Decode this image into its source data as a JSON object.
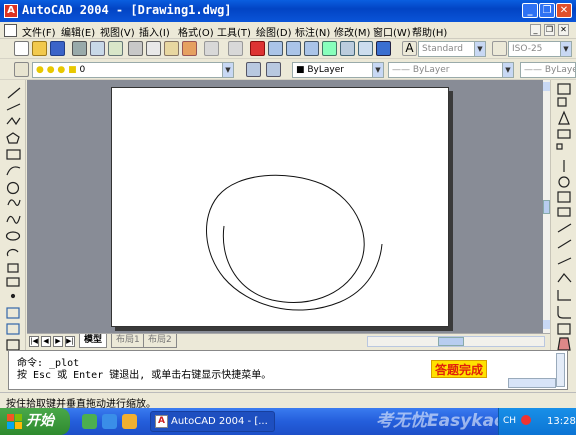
{
  "window": {
    "title": "AutoCAD 2004 - [Drawing1.dwg]",
    "app_icon_label": "A"
  },
  "menu": {
    "items": [
      "文件(F)",
      "编辑(E)",
      "视图(V)",
      "插入(I)",
      "格式(O)",
      "工具(T)",
      "绘图(D)",
      "标注(N)",
      "修改(M)",
      "窗口(W)",
      "帮助(H)"
    ]
  },
  "toolbar": {
    "text_style": "Standard",
    "dim_style": "ISO-25",
    "layer": "0",
    "color": "ByLayer",
    "linetype": "ByLayer",
    "lineweight": "ByLayer"
  },
  "tabs": {
    "model": "模型",
    "layout1": "布局1",
    "layout2": "布局2"
  },
  "command": {
    "line1": "命令: _plot",
    "line2": "按 Esc 或 Enter 键退出, 或单击右键显示快捷菜单。"
  },
  "answer_badge": "答题完成",
  "status": {
    "text": "按住拾取键并垂直拖动进行缩放。"
  },
  "taskbar": {
    "start_label": "开始",
    "task_label": "AutoCAD 2004 - [...",
    "watermark": "考无忧Easykao",
    "lang": "CH",
    "clock": "13:28"
  }
}
